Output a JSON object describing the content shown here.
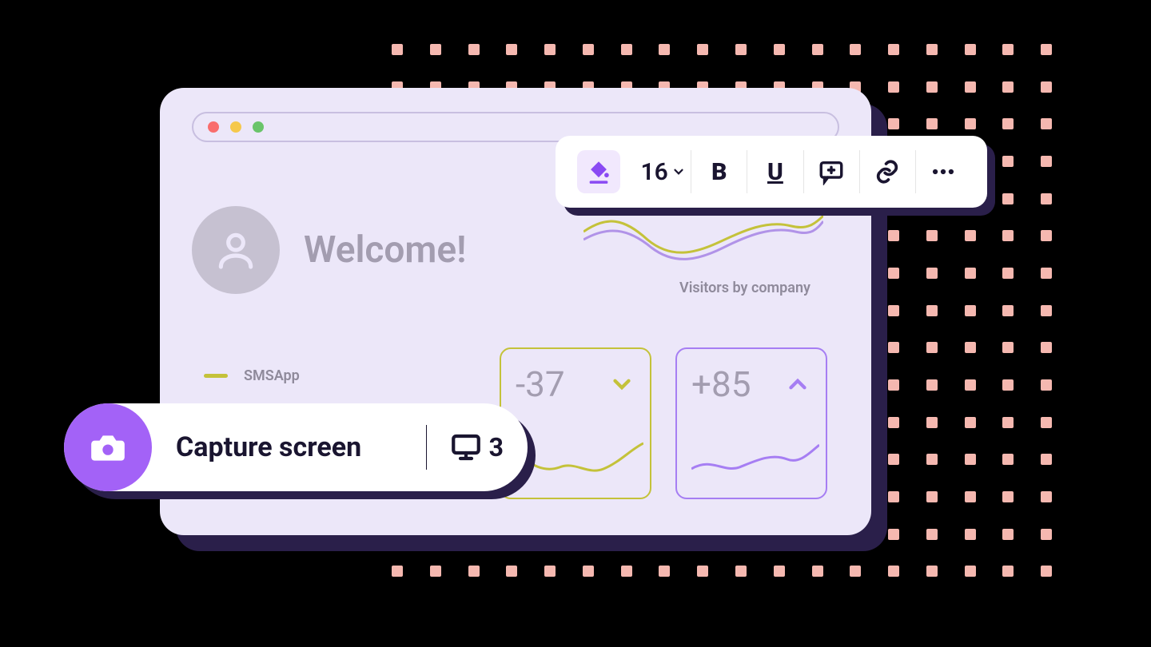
{
  "window": {
    "welcome": "Welcome!",
    "legend_label": "SMSApp",
    "chart_caption": "Visitors by company"
  },
  "stats": {
    "a": {
      "value": "-37"
    },
    "b": {
      "value": "+85"
    }
  },
  "toolbar": {
    "font_size": "16"
  },
  "capture": {
    "label": "Capture screen",
    "count": "3"
  },
  "colors": {
    "accent_purple": "#a362f7",
    "accent_olive": "#c4c23a",
    "panel_lilac": "#ece7f9",
    "shadow_navy": "#2a1f4a",
    "dot_coral": "#f5b8b0"
  }
}
